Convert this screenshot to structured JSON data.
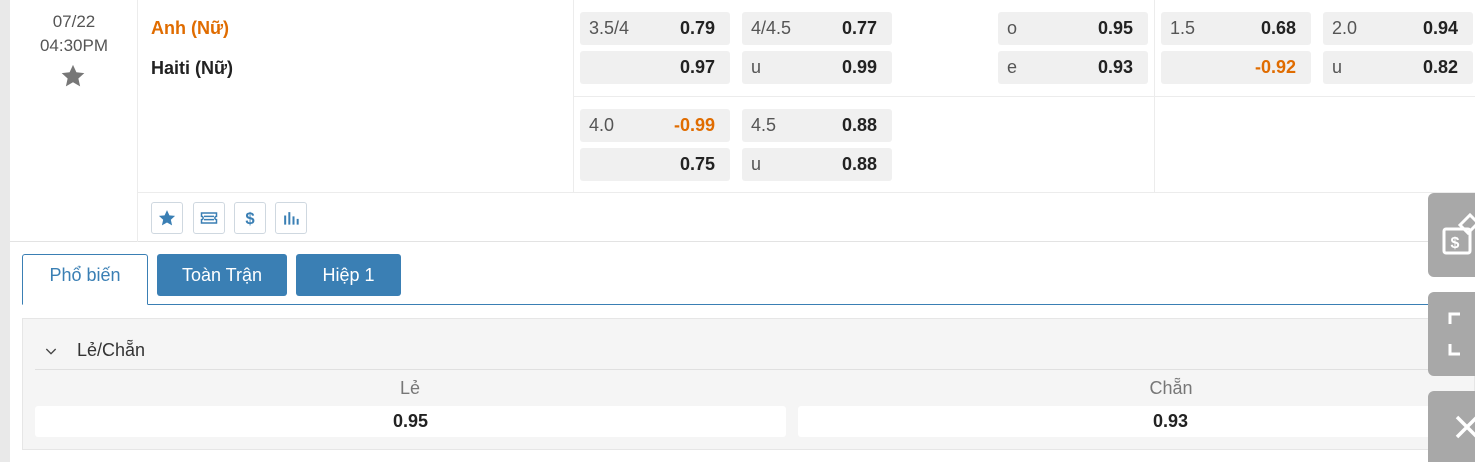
{
  "match": {
    "date": "07/22",
    "time": "04:30PM",
    "home_team": "Anh (Nữ)",
    "away_team": "Haiti (Nữ)",
    "favorite_icon": "star-icon",
    "main_odds": {
      "handicap_ft": {
        "line": "3.5/4",
        "home": "0.79",
        "away": "0.97"
      },
      "ou_ft": {
        "line": "4/4.5",
        "over": "0.77",
        "under_label": "u",
        "under": "0.99"
      },
      "odd_even": {
        "odd_label": "o",
        "odd": "0.95",
        "even_label": "e",
        "even": "0.93"
      },
      "handicap_h1": {
        "line": "1.5",
        "home": "0.68",
        "away": "-0.92"
      },
      "ou_h1": {
        "line": "2.0",
        "over": "0.94",
        "under_label": "u",
        "under": "0.82"
      }
    },
    "alt_odds": {
      "handicap_ft": {
        "line": "4.0",
        "home": "-0.99",
        "away": "0.75"
      },
      "ou_ft": {
        "line": "4.5",
        "over": "0.88",
        "under_label": "u",
        "under": "0.88"
      }
    },
    "action_icons": [
      "star-icon",
      "ticket-icon",
      "dollar-icon",
      "stats-icon"
    ]
  },
  "tabs": [
    {
      "label": "Phổ biến",
      "active": true
    },
    {
      "label": "Toàn Trận",
      "active": false
    },
    {
      "label": "Hiệp 1",
      "active": false
    }
  ],
  "market": {
    "title": "Lẻ/Chẵn",
    "odd_label": "Lẻ",
    "even_label": "Chẵn",
    "odd_value": "0.95",
    "even_value": "0.93"
  },
  "floating_tools": [
    "bet-slip-icon",
    "fullscreen-icon",
    "close-icon"
  ],
  "colors": {
    "accent": "#3a7fb4",
    "negative": "#e06c00",
    "home_team": "#e06c00"
  }
}
